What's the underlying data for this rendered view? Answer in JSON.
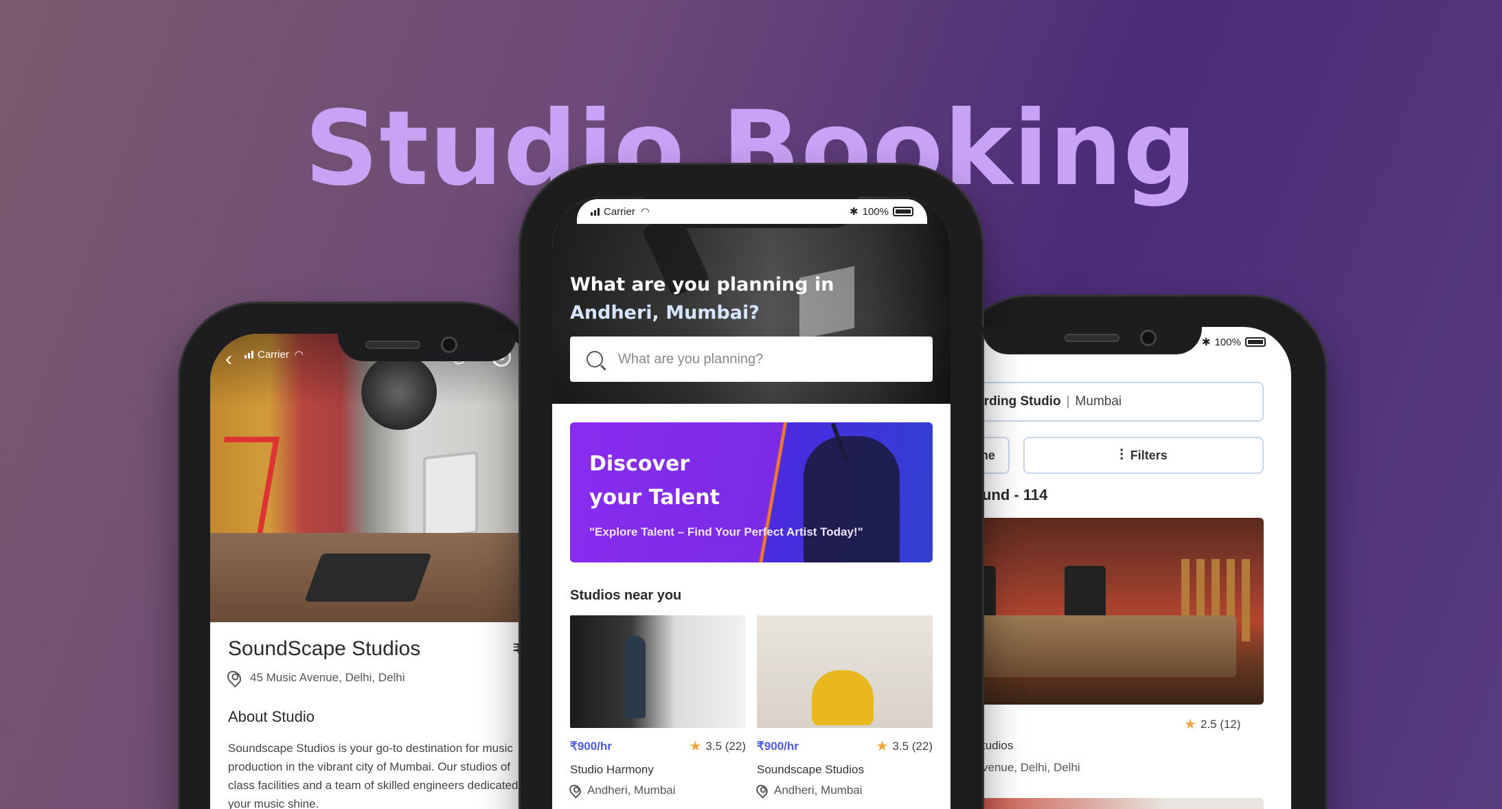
{
  "hero": {
    "title": "Studio Booking"
  },
  "colors": {
    "accent": "#c8a2f5",
    "price": "#4a5bd8",
    "star": "#f2a53a",
    "banner": "#8a2cf0"
  },
  "left_phone": {
    "status": {
      "carrier": "Carrier"
    },
    "icons": {
      "back": "back-arrow-icon",
      "call": "phone-icon",
      "whatsapp": "whatsapp-icon"
    },
    "studio_name": "SoundScape Studios",
    "price_partial": "₹",
    "address": "45 Music Avenue, Delhi, Delhi",
    "about_heading": "About Studio",
    "about_text": "Soundscape Studios is your go-to destination for music production in the vibrant city of Mumbai. Our studios of class facilities and a team of skilled engineers dedicated your music shine."
  },
  "center_phone": {
    "status": {
      "carrier": "Carrier",
      "battery": "100%"
    },
    "heading_line1": "What are you planning in",
    "heading_location": "Andheri, Mumbai?",
    "search": {
      "placeholder": "What are you planning?"
    },
    "banner": {
      "title_line1": "Discover",
      "title_line2": "your Talent",
      "subtitle": "\"Explore Talent – Find Your Perfect Artist Today!\""
    },
    "section_title": "Studios near you",
    "studios": [
      {
        "price": "₹900/hr",
        "rating": "3.5 (22)",
        "name": "Studio Harmony",
        "location": "Andheri, Mumbai"
      },
      {
        "price": "₹900/hr",
        "rating": "3.5 (22)",
        "name": "Soundscape Studios",
        "location": "Andheri, Mumbai"
      }
    ]
  },
  "right_phone": {
    "status": {
      "battery": "100%"
    },
    "search": {
      "category": "ecording Studio",
      "separator": "|",
      "city": "Mumbai"
    },
    "time_button": "d Time",
    "filters_button": "Filters",
    "results_count": "und - 114",
    "result": {
      "rating": "2.5 (12)",
      "name": "tudios",
      "address": "venue, Delhi, Delhi"
    }
  }
}
